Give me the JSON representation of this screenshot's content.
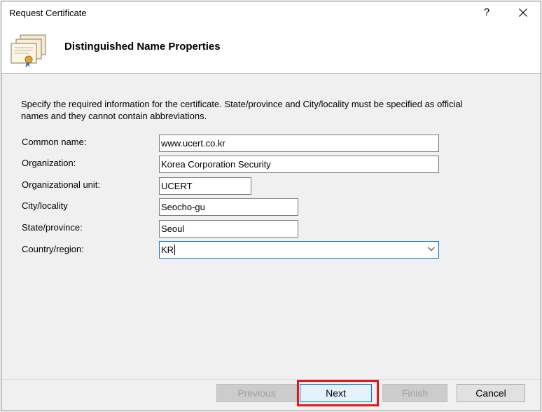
{
  "window": {
    "title": "Request Certificate",
    "help_label": "?",
    "close_icon": "close-icon"
  },
  "header": {
    "title": "Distinguished Name Properties",
    "icon": "certificate-stack-icon"
  },
  "instructions": "Specify the required information for the certificate. State/province and City/locality must be specified as official names and they cannot contain abbreviations.",
  "fields": [
    {
      "label": "Common name:",
      "value": "www.ucert.co.kr"
    },
    {
      "label": "Organization:",
      "value": "Korea Corporation Security"
    },
    {
      "label": "Organizational unit:",
      "value": "UCERT"
    },
    {
      "label": "City/locality",
      "value": "Seocho-gu"
    },
    {
      "label": "State/province:",
      "value": "Seoul"
    },
    {
      "label": "Country/region:",
      "value": "KR"
    }
  ],
  "buttons": {
    "previous": "Previous",
    "next": "Next",
    "finish": "Finish",
    "cancel": "Cancel"
  },
  "colors": {
    "highlight": "#e3161c",
    "focus": "#0078d7"
  }
}
